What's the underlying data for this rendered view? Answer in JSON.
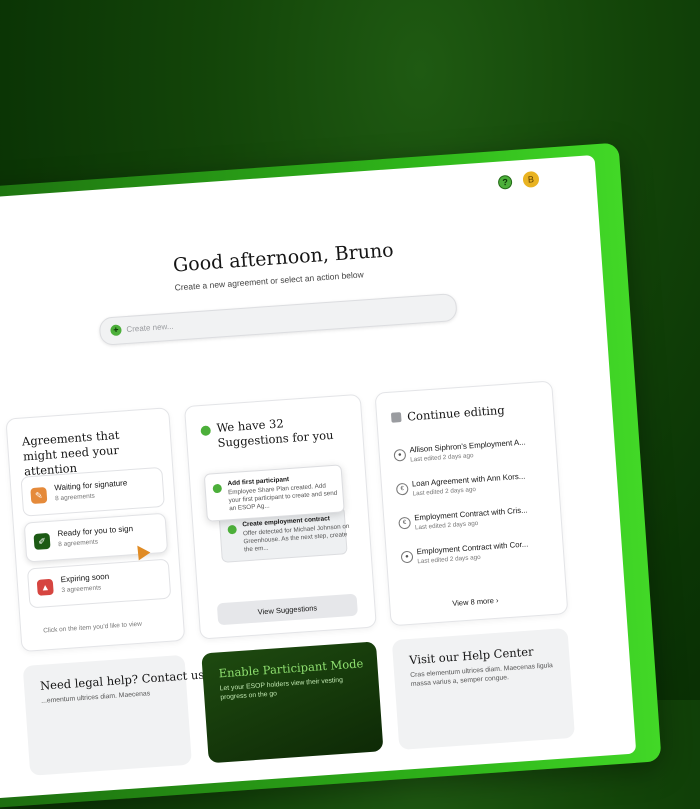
{
  "header": {
    "help_icon": "question-icon",
    "help_symbol": "?",
    "avatar_initial": "B"
  },
  "greeting": {
    "title": "Good afternoon, Bruno",
    "subtitle": "Create a new agreement or select an action below"
  },
  "search": {
    "placeholder": "Create new...",
    "icon": "plus-icon",
    "icon_glyph": "+"
  },
  "attention_card": {
    "title": "Agreements that might need your attention",
    "items": [
      {
        "title": "Waiting for signature",
        "subtitle": "8 agreements",
        "color": "#e58a3a",
        "icon": "signature-icon"
      },
      {
        "title": "Ready for you to sign",
        "subtitle": "8 agreements",
        "color": "#1c5a14",
        "icon": "pen-icon"
      },
      {
        "title": "Expiring soon",
        "subtitle": "3 agreements",
        "color": "#d64540",
        "icon": "warning-icon"
      }
    ],
    "hint": "Click on the item you'd like to view"
  },
  "suggestions_card": {
    "title": "We have 32 Suggestions for you",
    "suggestions": [
      {
        "title": "Add first participant",
        "desc": "Employee Share Plan created. Add your first participant to create and send an ESOP Ag..."
      },
      {
        "title": "Create employment contract",
        "desc": "Offer detected for Michael Johnson on Greenhouse. As the next step, create the em..."
      }
    ],
    "button": "View Suggestions"
  },
  "continue_card": {
    "title": "Continue editing",
    "rows": [
      {
        "title": "Allison Siphron's Employment A...",
        "subtitle": "Last edited 2 days ago",
        "icon": "person-icon"
      },
      {
        "title": "Loan Agreement with Ann Kors...",
        "subtitle": "Last edited 2 days ago",
        "icon": "euro-icon"
      },
      {
        "title": "Employment Contract with Cris...",
        "subtitle": "Last edited 2 days ago",
        "icon": "euro-icon"
      },
      {
        "title": "Employment Contract with Cor...",
        "subtitle": "Last edited 2 days ago",
        "icon": "person-icon"
      }
    ],
    "view_more": "View 8 more"
  },
  "bottom": {
    "legal": {
      "title": "Need legal help? Contact us",
      "text": "...ementum ultrices diam. Maecenas"
    },
    "participant": {
      "title": "Enable Participant Mode",
      "text": "Let your ESOP holders view their vesting progress on the go"
    },
    "help": {
      "title": "Visit our Help Center",
      "text": "Cras elementum ultrices diam. Maecenas ligula massa varius a, semper congue."
    }
  },
  "colors": {
    "brand": "#4caf3a",
    "background": "#0b3505"
  }
}
